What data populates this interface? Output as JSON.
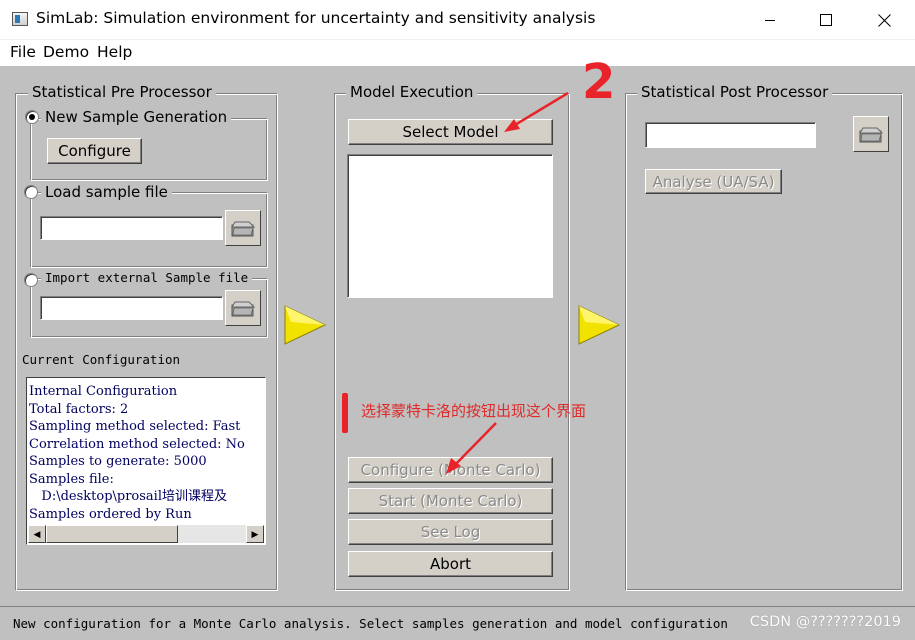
{
  "window": {
    "title": "SimLab: Simulation environment for uncertainty and sensitivity analysis",
    "icons": [
      "app-icon",
      "minimize-icon",
      "maximize-icon",
      "close-icon"
    ]
  },
  "menu": {
    "items": [
      {
        "label": "File"
      },
      {
        "label": "Demo"
      },
      {
        "label": "Help"
      }
    ]
  },
  "pre": {
    "title": "Statistical Pre Processor",
    "new_sample": {
      "label": "New Sample Generation",
      "selected": true
    },
    "configure": "Configure",
    "load_sample": {
      "label": "Load sample file",
      "selected": false,
      "value": ""
    },
    "import_external": {
      "label": "Import external Sample file",
      "selected": false,
      "value": ""
    },
    "current_config_label": "Current Configuration",
    "config_lines": [
      "Internal Configuration",
      "Total factors: 2",
      "Sampling method selected: Fast",
      "Correlation method selected: No",
      "Samples to generate: 5000",
      "Samples file:",
      "   D:\\desktop\\prosail培训课程及",
      "Samples ordered by Run"
    ]
  },
  "model": {
    "title": "Model Execution",
    "select_model": "Select Model",
    "configure_mc": "Configure (Monte Carlo)",
    "start_mc": "Start (Monte Carlo)",
    "see_log": "See Log",
    "abort": "Abort"
  },
  "post": {
    "title": "Statistical Post Processor",
    "file_value": "",
    "analyse": "Analyse (UA/SA)"
  },
  "annotations": {
    "number_label": "2",
    "note": "选择蒙特卡洛的按钮出现这个界面",
    "color": "#e8242a"
  },
  "status": {
    "text": "New configuration for a Monte Carlo analysis. Select samples generation and model configuration",
    "watermark": "CSDN @???????2019"
  },
  "colors": {
    "background": "#c0c0c0",
    "arrow": "#f2e200",
    "config_text": "#000060"
  }
}
